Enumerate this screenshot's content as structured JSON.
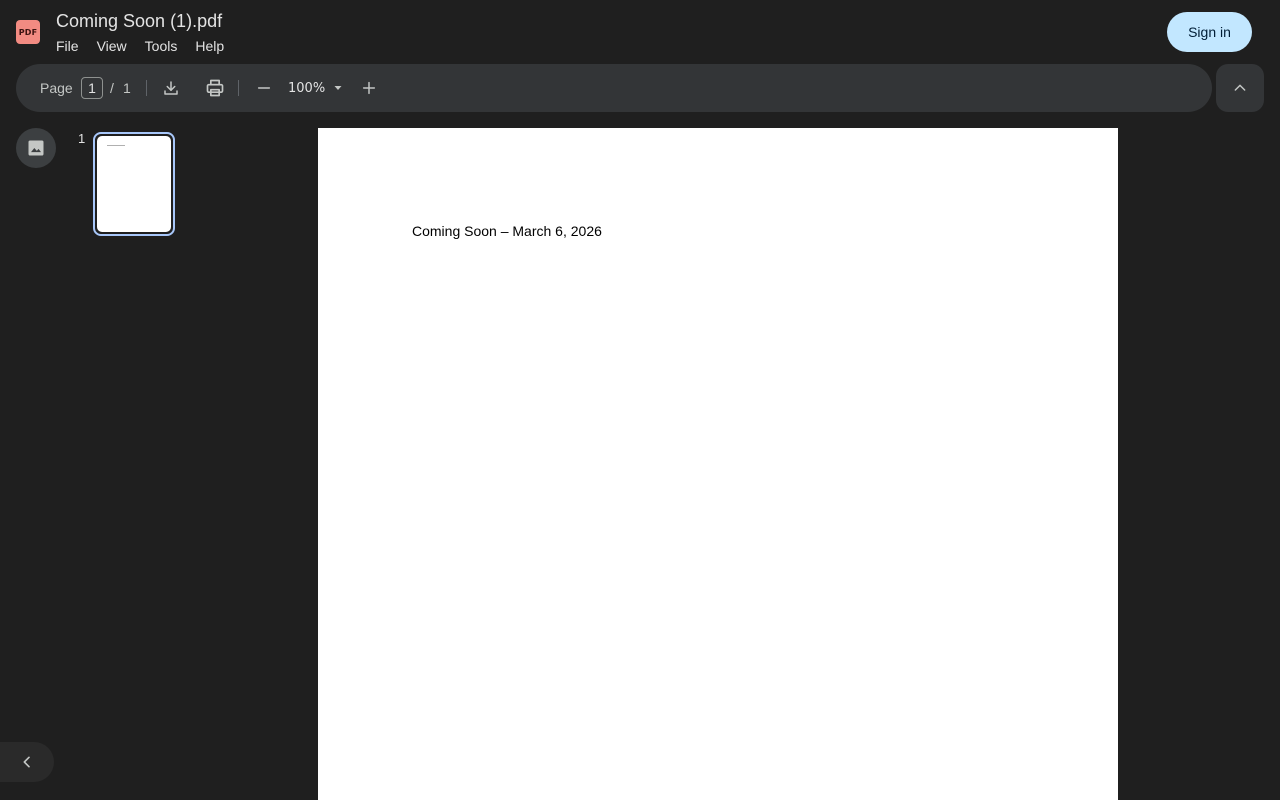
{
  "app": {
    "logo_text": "PDF",
    "title": "Coming Soon (1).pdf",
    "sign_in_label": "Sign in"
  },
  "menu": {
    "items": [
      "File",
      "View",
      "Tools",
      "Help"
    ]
  },
  "toolbar": {
    "page_label": "Page",
    "current_page": "1",
    "separator": "/",
    "total_pages": "1",
    "zoom": "100%",
    "icons": [
      "download-icon",
      "print-icon",
      "zoom-out-icon",
      "zoom-dropdown-icon",
      "zoom-in-icon",
      "chevron-up-icon"
    ]
  },
  "sidebar": {
    "thumbnail_number": "1",
    "icons": [
      "image-icon",
      "chevron-left-icon"
    ]
  },
  "document": {
    "text": "Coming Soon – March 6, 2026"
  },
  "colors": {
    "background": "#1f1f1f",
    "toolbar": "#333537",
    "sign_in_bg": "#c2e7ff",
    "thumbnail_border": "#a8c7fa",
    "logo_bg": "#f28b82"
  }
}
